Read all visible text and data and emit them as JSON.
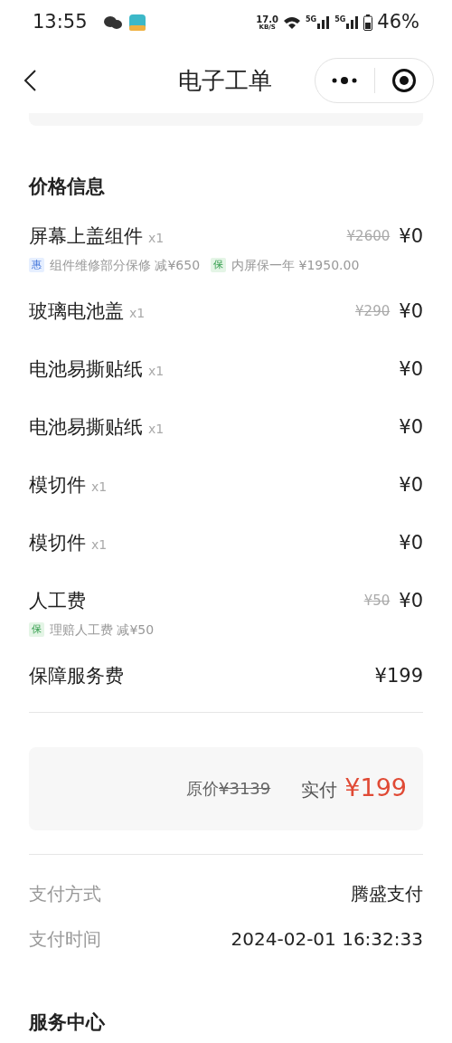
{
  "status_bar": {
    "time": "13:55",
    "speed": "17.0",
    "speed_unit": "KB/S",
    "network_1": "5G",
    "network_2": "5G",
    "battery": "46%"
  },
  "nav": {
    "title": "电子工单"
  },
  "price_section": {
    "title": "价格信息",
    "items": [
      {
        "name": "屏幕上盖组件",
        "qty": "x1",
        "original": "¥2600",
        "price": "¥0",
        "tags": [
          {
            "kind": "discount",
            "badge": "惠",
            "text": "组件维修部分保修 减¥650"
          },
          {
            "kind": "warranty",
            "badge": "保",
            "text": "内屏保一年 ¥1950.00"
          }
        ]
      },
      {
        "name": "玻璃电池盖",
        "qty": "x1",
        "original": "¥290",
        "price": "¥0"
      },
      {
        "name": "电池易撕贴纸",
        "qty": "x1",
        "price": "¥0"
      },
      {
        "name": "电池易撕贴纸",
        "qty": "x1",
        "price": "¥0"
      },
      {
        "name": "模切件",
        "qty": "x1",
        "price": "¥0"
      },
      {
        "name": "模切件",
        "qty": "x1",
        "price": "¥0"
      },
      {
        "name": "人工费",
        "original": "¥50",
        "price": "¥0",
        "tags": [
          {
            "kind": "warranty",
            "badge": "保",
            "text": "理赔人工费 减¥50"
          }
        ]
      },
      {
        "name": "保障服务费",
        "price": "¥199"
      }
    ]
  },
  "summary": {
    "original_label": "原价",
    "original": "¥3139",
    "paid_label": "实付",
    "paid": "¥199"
  },
  "payment": [
    {
      "label": "支付方式",
      "value": "腾盛支付"
    },
    {
      "label": "支付时间",
      "value": "2024-02-01 16:32:33"
    }
  ],
  "next_section": {
    "title": "服务中心"
  }
}
